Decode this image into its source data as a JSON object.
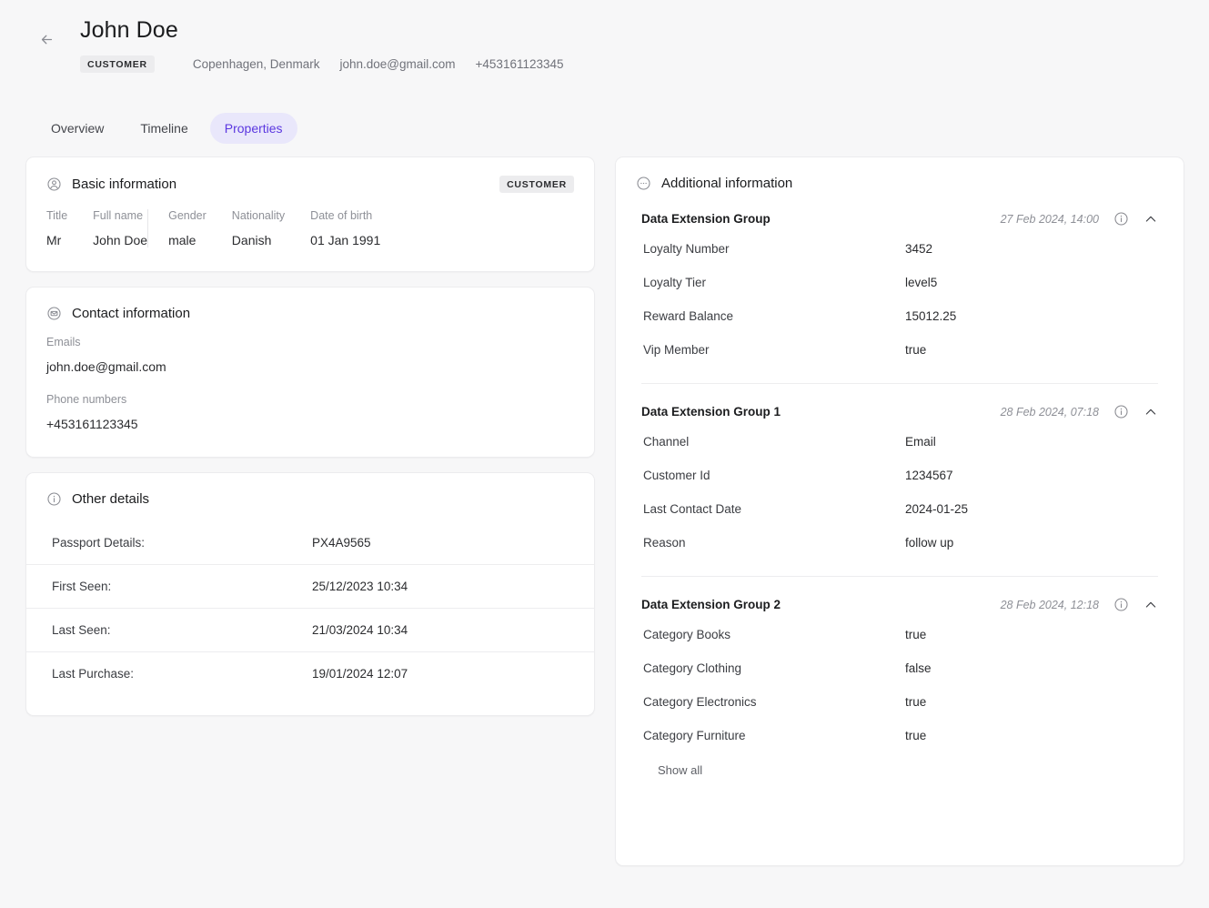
{
  "header": {
    "back_icon": "arrow-left-icon",
    "title": "John Doe",
    "badge": "CUSTOMER",
    "location": "Copenhagen, Denmark",
    "email": "john.doe@gmail.com",
    "phone": "+453161123345"
  },
  "tabs": [
    {
      "label": "Overview",
      "active": false
    },
    {
      "label": "Timeline",
      "active": false
    },
    {
      "label": "Properties",
      "active": true
    }
  ],
  "accent_color": "#5b37e0",
  "accent_bg": "#e9e7fb",
  "basic_information": {
    "icon": "user-circle-icon",
    "title": "Basic information",
    "badge": "CUSTOMER",
    "fields_left": [
      {
        "label": "Title",
        "value": "Mr"
      },
      {
        "label": "Full name",
        "value": "John Doe"
      }
    ],
    "fields_right": [
      {
        "label": "Gender",
        "value": "male"
      },
      {
        "label": "Nationality",
        "value": "Danish"
      },
      {
        "label": "Date of birth",
        "value": "01 Jan 1991"
      }
    ]
  },
  "contact_information": {
    "icon": "envelope-circle-icon",
    "title": "Contact information",
    "emails_label": "Emails",
    "emails_value": "john.doe@gmail.com",
    "phones_label": "Phone numbers",
    "phones_value": "+453161123345"
  },
  "other_details": {
    "icon": "info-circle-icon",
    "title": "Other details",
    "rows": [
      {
        "key": "Passport Details:",
        "value": "PX4A9565"
      },
      {
        "key": "First Seen:",
        "value": "25/12/2023 10:34"
      },
      {
        "key": "Last Seen:",
        "value": "21/03/2024 10:34"
      },
      {
        "key": "Last Purchase:",
        "value": "19/01/2024 12:07"
      }
    ]
  },
  "additional_information": {
    "icon": "ellipsis-circle-icon",
    "title": "Additional information",
    "show_all_label": "Show all",
    "groups": [
      {
        "name": "Data Extension Group",
        "date": "27 Feb 2024, 14:00",
        "info_icon": "info-circle-icon",
        "toggle_icon": "chevron-up-icon",
        "expanded": true,
        "rows": [
          {
            "key": "Loyalty Number",
            "value": "3452"
          },
          {
            "key": "Loyalty Tier",
            "value": "level5"
          },
          {
            "key": "Reward Balance",
            "value": "15012.25"
          },
          {
            "key": "Vip Member",
            "value": "true"
          }
        ],
        "has_show_all": false
      },
      {
        "name": "Data Extension Group 1",
        "date": "28 Feb 2024, 07:18",
        "info_icon": "info-circle-icon",
        "toggle_icon": "chevron-up-icon",
        "expanded": true,
        "rows": [
          {
            "key": "Channel",
            "value": "Email"
          },
          {
            "key": "Customer Id",
            "value": "1234567"
          },
          {
            "key": "Last Contact Date",
            "value": "2024-01-25"
          },
          {
            "key": "Reason",
            "value": "follow up"
          }
        ],
        "has_show_all": false
      },
      {
        "name": "Data Extension Group 2",
        "date": "28 Feb 2024, 12:18",
        "info_icon": "info-circle-icon",
        "toggle_icon": "chevron-up-icon",
        "expanded": true,
        "rows": [
          {
            "key": "Category Books",
            "value": "true"
          },
          {
            "key": "Category Clothing",
            "value": "false"
          },
          {
            "key": "Category Electronics",
            "value": "true"
          },
          {
            "key": "Category Furniture",
            "value": "true"
          }
        ],
        "has_show_all": true
      }
    ]
  }
}
